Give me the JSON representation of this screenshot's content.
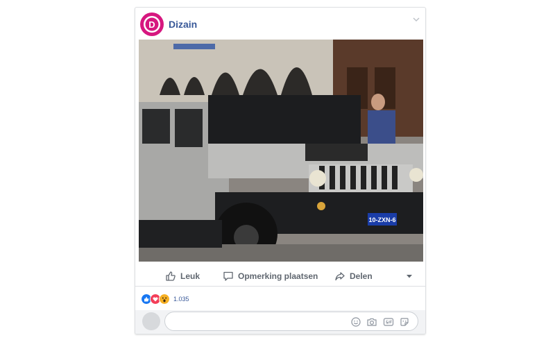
{
  "post": {
    "page_name": "Dizain",
    "logo_letter": "D",
    "photo_plate": "10-ZXN-6"
  },
  "actions": {
    "like_label": "Leuk",
    "comment_label": "Opmerking plaatsen",
    "share_label": "Delen"
  },
  "reactions": {
    "count": "1.035",
    "types": [
      "like-icon",
      "love-icon",
      "wow-icon"
    ]
  },
  "comment": {
    "placeholder": ""
  },
  "colors": {
    "brand": "#d6177f",
    "link": "#385898",
    "action_text": "#606770"
  }
}
